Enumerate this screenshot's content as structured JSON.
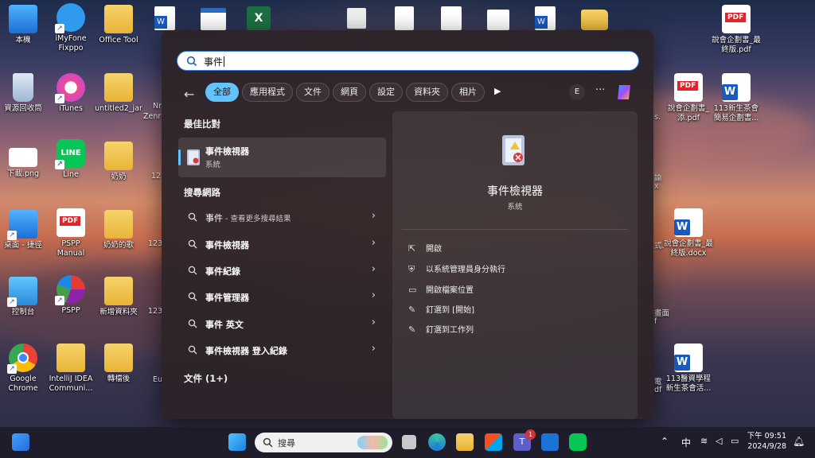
{
  "desktop": {
    "icons_left": [
      {
        "label": "本機",
        "kind": "pc"
      },
      {
        "label": "iMyFone Fixppo",
        "kind": "app"
      },
      {
        "label": "Office Tool",
        "kind": "folder"
      },
      {
        "label": "資源回收筒",
        "kind": "recycle"
      },
      {
        "label": "iTunes",
        "kind": "app"
      },
      {
        "label": "untitled2_jar",
        "kind": "folder"
      },
      {
        "label": "下載.png",
        "kind": "image"
      },
      {
        "label": "Line",
        "kind": "app"
      },
      {
        "label": "奶奶",
        "kind": "folder"
      },
      {
        "label": "桌面 - 捷徑",
        "kind": "folder"
      },
      {
        "label": "PSPP Manual",
        "kind": "pdf"
      },
      {
        "label": "奶奶的歌",
        "kind": "folder"
      },
      {
        "label": "控制台",
        "kind": "app"
      },
      {
        "label": "PSPP",
        "kind": "app"
      },
      {
        "label": "新增資料夾",
        "kind": "folder"
      },
      {
        "label": "Google Chrome",
        "kind": "app"
      },
      {
        "label": "IntelliJ IDEA Communi...",
        "kind": "folder"
      },
      {
        "label": "轉檔後",
        "kind": "folder"
      }
    ],
    "icons_right": [
      {
        "label": "說會企劃書_最終版.pdf",
        "kind": "pdf"
      },
      {
        "label": "說會企劃書_添.pdf",
        "kind": "pdf"
      },
      {
        "label": "113新生茶會簡易企劃書...",
        "kind": "word"
      },
      {
        "label": "說會企劃書_最終版.docx",
        "kind": "word"
      },
      {
        "label": "113醫資學程新生茶會活...",
        "kind": "word"
      }
    ],
    "partial_labels": {
      "nr": "Nr",
      "zenr": "Zenr",
      "s12": "12",
      "s123a": "123",
      "s123b": "123",
      "eu": "Eu",
      "r1": "論",
      "r2": "x",
      "r3": "式.",
      "r4": "畫面",
      "r5": "f",
      "r6": "電",
      "r7": "df",
      "r8": "s."
    }
  },
  "search": {
    "query": "事件",
    "filters": [
      "全部",
      "應用程式",
      "文件",
      "網頁",
      "設定",
      "資料夾",
      "相片"
    ],
    "active_filter": "全部",
    "account_initial": "E",
    "more": "···",
    "best_match_title": "最佳比對",
    "best_match": {
      "name": "事件檢視器",
      "kind": "系統"
    },
    "web_title": "搜尋網路",
    "web_results": [
      {
        "text": "事件",
        "sub": " - 查看更多搜尋結果"
      },
      {
        "text": "事件檢視器",
        "sub": ""
      },
      {
        "text": "事件紀錄",
        "sub": ""
      },
      {
        "text": "事件管理器",
        "sub": ""
      },
      {
        "text": "事件 英文",
        "sub": ""
      },
      {
        "text": "事件檢視器 登入紀錄",
        "sub": ""
      }
    ],
    "documents_title": "文件 (1+)",
    "detail": {
      "name": "事件檢視器",
      "kind": "系統",
      "actions": [
        "開啟",
        "以系統管理員身分執行",
        "開啟檔案位置",
        "釘選到 [開始]",
        "釘選到工作列"
      ]
    }
  },
  "taskbar": {
    "search_label": "搜尋",
    "teams_badge": "1",
    "ime": "中",
    "time": "下午 09:51",
    "date": "2024/9/28"
  },
  "colors": {
    "accent": "#63c3ff",
    "panel": "#2c2428",
    "pdf": "#e3222a",
    "word": "#185abd"
  }
}
